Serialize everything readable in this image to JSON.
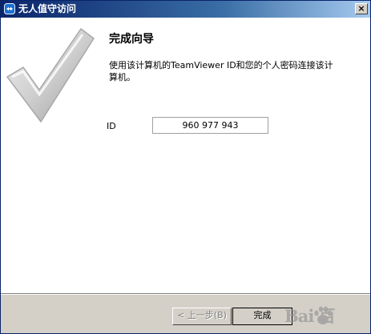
{
  "window": {
    "title": "无人值守访问",
    "close_glyph": "×"
  },
  "wizard": {
    "heading": "完成向导",
    "description": "使用该计算机的TeamViewer ID和您的个人密码连接该计算机。",
    "id_label": "ID",
    "id_value": "960 977 943"
  },
  "buttons": {
    "back": "< 上一步(B)",
    "finish": "完成"
  },
  "watermark": {
    "text": "Bai 百"
  },
  "colors": {
    "title_start": "#0a246a",
    "title_end": "#a6caf0",
    "content_bg": "#ffffff",
    "chrome_bg": "#d4d0c8"
  },
  "icons": {
    "title": "teamviewer-icon",
    "wizard": "checkmark-icon",
    "watermark": "paw-icon"
  }
}
